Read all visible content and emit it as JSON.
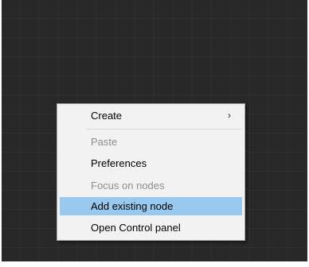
{
  "context_menu": {
    "items": [
      {
        "label": "Create",
        "state": "enabled",
        "has_submenu": true,
        "submenu_icon": "chevron-right-icon"
      },
      {
        "label": "Paste",
        "state": "disabled"
      },
      {
        "label": "Preferences",
        "state": "enabled"
      },
      {
        "label": "Focus on nodes",
        "state": "disabled"
      },
      {
        "label": "Add existing node",
        "state": "highlighted"
      },
      {
        "label": "Open Control panel",
        "state": "enabled"
      }
    ],
    "submenu_arrow_glyph": "›"
  },
  "colors": {
    "canvas_background": "#282828",
    "canvas_grid": "#303030",
    "menu_background": "#f2f2f2",
    "menu_highlight": "#99c9ef",
    "disabled_text": "#8e8e8e"
  }
}
